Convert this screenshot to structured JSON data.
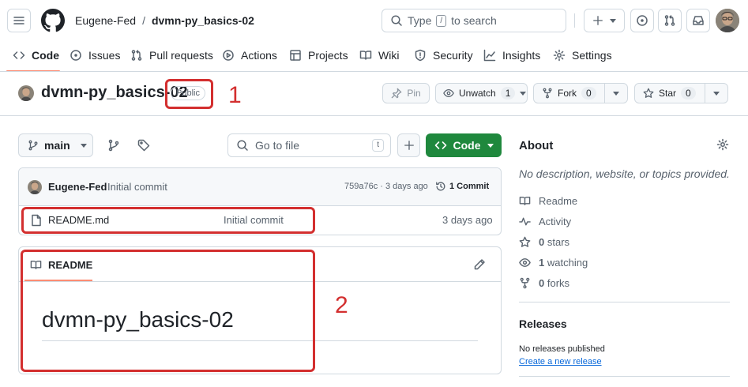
{
  "header": {
    "owner": "Eugene-Fed",
    "separator": "/",
    "repo": "dvmn-py_basics-02",
    "search_type": "Type",
    "search_key": "/",
    "search_rest": "to search"
  },
  "tabs": [
    {
      "label": "Code",
      "icon": "code-icon"
    },
    {
      "label": "Issues",
      "icon": "issue-icon"
    },
    {
      "label": "Pull requests",
      "icon": "pull-request-icon"
    },
    {
      "label": "Actions",
      "icon": "play-icon"
    },
    {
      "label": "Projects",
      "icon": "table-icon"
    },
    {
      "label": "Wiki",
      "icon": "book-icon"
    },
    {
      "label": "Security",
      "icon": "shield-icon"
    },
    {
      "label": "Insights",
      "icon": "graph-icon"
    },
    {
      "label": "Settings",
      "icon": "gear-icon"
    }
  ],
  "repo_title": {
    "name": "dvmn-py_basics-02",
    "visibility": "Public",
    "pin": "Pin",
    "unwatch": "Unwatch",
    "unwatch_count": "1",
    "fork": "Fork",
    "fork_count": "0",
    "star": "Star",
    "star_count": "0"
  },
  "filebar": {
    "branch": "main",
    "go_to_file": "Go to file",
    "shortcut": "t",
    "code": "Code"
  },
  "commit": {
    "author": "Eugene-Fed",
    "message": "Initial commit",
    "sha_date": "759a76c · 3 days ago",
    "commits": "1 Commit"
  },
  "files": [
    {
      "name": "README.md",
      "message": "Initial commit",
      "age": "3 days ago"
    }
  ],
  "readme": {
    "tab": "README",
    "heading": "dvmn-py_basics-02"
  },
  "about": {
    "title": "About",
    "description": "No description, website, or topics provided.",
    "links": [
      {
        "label": "Readme",
        "icon": "book-icon"
      },
      {
        "label": "Activity",
        "icon": "pulse-icon"
      },
      {
        "strong": "0",
        "label": "stars",
        "icon": "star-icon"
      },
      {
        "strong": "1",
        "label": "watching",
        "icon": "eye-icon"
      },
      {
        "strong": "0",
        "label": "forks",
        "icon": "fork-icon"
      }
    ]
  },
  "releases": {
    "title": "Releases",
    "none": "No releases published",
    "create": "Create a new release"
  },
  "annotations": {
    "one": "1",
    "two": "2",
    "color": "#d32f2f"
  }
}
